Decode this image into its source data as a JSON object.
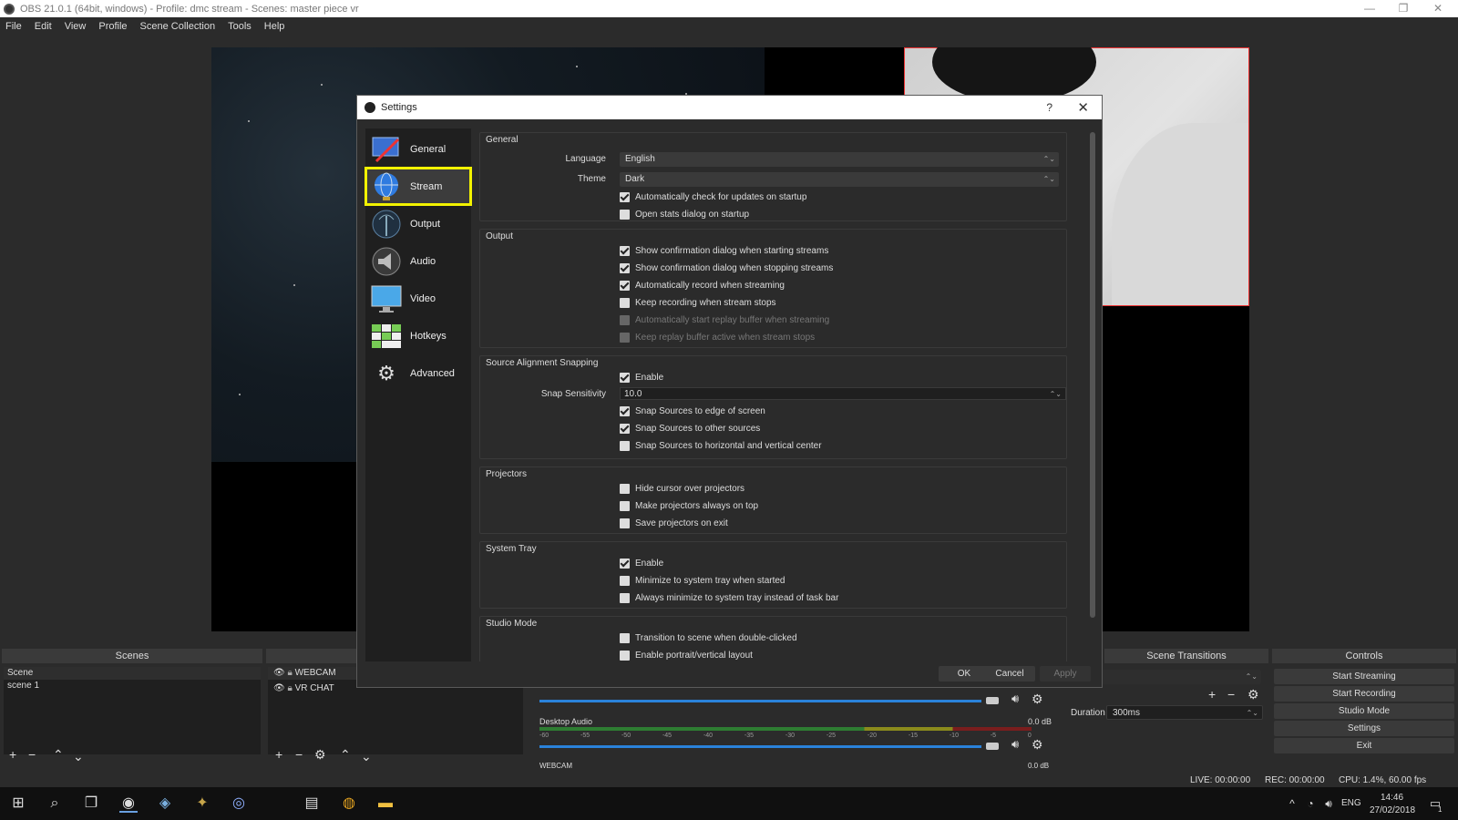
{
  "window": {
    "title": "OBS 21.0.1 (64bit, windows) - Profile: dmc stream - Scenes: master piece vr",
    "minimize": "—",
    "maximize": "❐",
    "close": "✕"
  },
  "menu": [
    "File",
    "Edit",
    "View",
    "Profile",
    "Scene Collection",
    "Tools",
    "Help"
  ],
  "docks": {
    "scenes": {
      "title": "Scenes",
      "items": [
        "Scene",
        "scene 1"
      ]
    },
    "sources": {
      "items": [
        "WEBCAM",
        "VR CHAT"
      ]
    },
    "mixer": {
      "ticks": [
        "-60",
        "-55",
        "-50",
        "-45",
        "-40",
        "-35",
        "-30",
        "-25",
        "-20",
        "-15",
        "-10",
        "-5",
        "0"
      ],
      "channels": [
        {
          "name": "Desktop Audio",
          "db": "0.0 dB"
        },
        {
          "name": "WEBCAM",
          "db": "0.0 dB"
        }
      ]
    },
    "transitions": {
      "title": "Scene Transitions",
      "duration_label": "Duration",
      "duration_value": "300ms"
    },
    "controls": {
      "title": "Controls",
      "buttons": [
        "Start Streaming",
        "Start Recording",
        "Studio Mode",
        "Settings",
        "Exit"
      ]
    }
  },
  "status": {
    "live": "LIVE: 00:00:00",
    "rec": "REC: 00:00:00",
    "cpu": "CPU: 1.4%, 60.00 fps"
  },
  "taskbar": {
    "lang": "ENG",
    "time": "14:46",
    "date": "27/02/2018",
    "notif": "1"
  },
  "settings": {
    "title": "Settings",
    "help": "?",
    "close": "✕",
    "nav": [
      {
        "label": "General",
        "icon": "general-icon"
      },
      {
        "label": "Stream",
        "icon": "globe-icon"
      },
      {
        "label": "Output",
        "icon": "antenna-icon"
      },
      {
        "label": "Audio",
        "icon": "speaker-icon"
      },
      {
        "label": "Video",
        "icon": "monitor-icon"
      },
      {
        "label": "Hotkeys",
        "icon": "keyboard-icon"
      },
      {
        "label": "Advanced",
        "icon": "gears-icon"
      }
    ],
    "selected_nav": "Stream",
    "groups": {
      "general": {
        "title": "General",
        "language_label": "Language",
        "language_value": "English",
        "theme_label": "Theme",
        "theme_value": "Dark",
        "checks": [
          {
            "label": "Automatically check for updates on startup",
            "checked": true
          },
          {
            "label": "Open stats dialog on startup",
            "checked": false
          }
        ]
      },
      "output": {
        "title": "Output",
        "checks": [
          {
            "label": "Show confirmation dialog when starting streams",
            "checked": true
          },
          {
            "label": "Show confirmation dialog when stopping streams",
            "checked": true
          },
          {
            "label": "Automatically record when streaming",
            "checked": true
          },
          {
            "label": "Keep recording when stream stops",
            "checked": false
          },
          {
            "label": "Automatically start replay buffer when streaming",
            "checked": false,
            "disabled": true
          },
          {
            "label": "Keep replay buffer active when stream stops",
            "checked": false,
            "disabled": true
          }
        ]
      },
      "snapping": {
        "title": "Source Alignment Snapping",
        "enable_label": "Enable",
        "sensitivity_label": "Snap Sensitivity",
        "sensitivity_value": "10.0",
        "checks": [
          {
            "label": "Snap Sources to edge of screen",
            "checked": true
          },
          {
            "label": "Snap Sources to other sources",
            "checked": true
          },
          {
            "label": "Snap Sources to horizontal and vertical center",
            "checked": false
          }
        ]
      },
      "projectors": {
        "title": "Projectors",
        "checks": [
          {
            "label": "Hide cursor over projectors",
            "checked": false
          },
          {
            "label": "Make projectors always on top",
            "checked": false
          },
          {
            "label": "Save projectors on exit",
            "checked": false
          }
        ]
      },
      "tray": {
        "title": "System Tray",
        "checks": [
          {
            "label": "Enable",
            "checked": true
          },
          {
            "label": "Minimize to system tray when started",
            "checked": false
          },
          {
            "label": "Always minimize to system tray instead of task bar",
            "checked": false
          }
        ]
      },
      "studio": {
        "title": "Studio Mode",
        "checks": [
          {
            "label": "Transition to scene when double-clicked",
            "checked": false
          },
          {
            "label": "Enable portrait/vertical layout",
            "checked": false
          }
        ]
      }
    },
    "buttons": {
      "ok": "OK",
      "cancel": "Cancel",
      "apply": "Apply"
    }
  },
  "colors": {
    "highlight": "#f2f200",
    "accent": "#2a82da"
  }
}
